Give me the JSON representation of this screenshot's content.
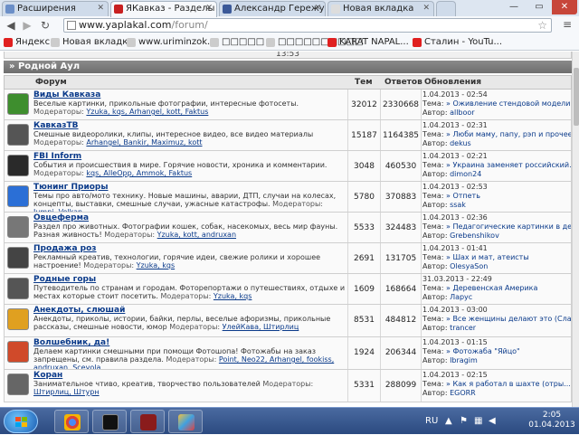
{
  "tabs": [
    {
      "label": "Расширения",
      "active": false
    },
    {
      "label": "ЯКавказ - Разделы",
      "active": true
    },
    {
      "label": "Александр Гережун",
      "active": false
    },
    {
      "label": "Новая вкладка",
      "active": false
    }
  ],
  "address": {
    "host": "www.yaplakal.com",
    "path": "/forum/"
  },
  "bookmarks": [
    "Яндекс",
    "Новая вкладка",
    "www.uriminzok...",
    "□□□□□",
    "□□□□□□□□□□",
    "KARAT NAPAL...",
    "Сталин - YouTu..."
  ],
  "category": "» Родной Аул",
  "prev_row_text": "13:53",
  "columns": {
    "forum": "Форум",
    "topics": "Тем",
    "replies": "Ответов",
    "updates": "Обновления"
  },
  "mods_label": "Модераторы:",
  "topic_label": "Тема:",
  "author_label": "Автор:",
  "forums": [
    {
      "title": "Виды Кавказа",
      "desc": "Веселые картинки, прикольные фотографии, интересные фотосеты.",
      "mods": "Yzuka, kqs, Arhangel, kott, Faktus",
      "topics": "32012",
      "replies": "2330668",
      "date": "1.04.2013 - 02:54",
      "topic": "» Оживление стендовой модели ...",
      "author": "allboor",
      "icon": "#3e8e2e"
    },
    {
      "title": "КавказТВ",
      "desc": "Смешные видеоролики, клипы, интересное видео, все видео материалы",
      "mods": "Arhangel, Bankir, Maximuz, kott",
      "topics": "15187",
      "replies": "1164385",
      "date": "1.04.2013 - 02:31",
      "topic": "» Люби маму, папу, рэп и прочее...",
      "author": "dekus",
      "icon": "#555555"
    },
    {
      "title": "FBI Inform",
      "desc": "События и происшествия в мире. Горячие новости, хроника и комментарии.",
      "mods": "kqs, AlleOpp, Ammok, Faktus",
      "topics": "3048",
      "replies": "460530",
      "date": "1.04.2013 - 02:21",
      "topic": "» Украина заменяет российский...",
      "author": "dimon24",
      "icon": "#2a2a2a"
    },
    {
      "title": "Тюнинг Приоры",
      "desc": "Темы про авто/мото технику. Новые машины, аварии, ДТП, случаи на колесах, концепты, выставки, смешные случаи, ужасные катастрофы.",
      "mods": "Jumpi, Velkan",
      "topics": "5780",
      "replies": "370883",
      "date": "1.04.2013 - 02:53",
      "topic": "» Отпеть",
      "author": "ssak",
      "icon": "#2b6fd6"
    },
    {
      "title": "Овцеферма",
      "desc": "Раздел про животных. Фотографии кошек, собак, насекомых, весь мир фауны. Разная живность!",
      "mods": "Yzuka, kott, andruxan",
      "topics": "5533",
      "replies": "324483",
      "date": "1.04.2013 - 02:36",
      "topic": "» Педагогические картинки в детско...",
      "author": "Grebenshikov",
      "icon": "#777777"
    },
    {
      "title": "Продажа роз",
      "desc": "Рекламный креатив, технологии, горячие идеи, свежие ролики и хорошее настроение!",
      "mods": "Yzuka, kqs",
      "topics": "2691",
      "replies": "131705",
      "date": "1.04.2013 - 01:41",
      "topic": "» Шах и мат, атеисты",
      "author": "OlesyaSon",
      "icon": "#444444"
    },
    {
      "title": "Родные горы",
      "desc": "Путеводитель по странам и городам. Фоторепортажи о путешествиях, отдыхе и местах которые стоит посетить.",
      "mods": "Yzuka, kqs",
      "topics": "1609",
      "replies": "168664",
      "date": "31.03.2013 - 22:49",
      "topic": "» Деревенская Америка",
      "author": "Ларус",
      "icon": "#555555"
    },
    {
      "title": "Анекдоты, слюшай",
      "desc": "Анекдоты, приколы, истории, байки, перлы, веселые афоризмы, прикольные рассказы, смешные новости, юмор",
      "mods": "УлейКава, Штирлиц",
      "topics": "8531",
      "replies": "484812",
      "date": "1.04.2013 - 03:00",
      "topic": "» Все женщины делают это (Сла...",
      "author": "trancer",
      "icon": "#e0a020"
    },
    {
      "title": "Волшебник, да!",
      "desc": "Делаем картинки смешными при помощи Фотошопа! Фотожабы на заказ запрещены, см. правила раздела.",
      "mods": "Point, Neo22, Arhangel, fookiss, andruxan, Scevola",
      "topics": "1924",
      "replies": "206344",
      "date": "1.04.2013 - 01:15",
      "topic": "» Фотожаба \"Яйцо\"",
      "author": "Ibragim",
      "icon": "#d04a2a"
    },
    {
      "title": "Коран",
      "desc": "Занимательное чтиво, креатив, творчество пользователей",
      "mods": "Штирлиц, Штурн",
      "topics": "5331",
      "replies": "288099",
      "date": "1.04.2013 - 02:15",
      "topic": "» Как я работал в шахте (отры...",
      "author": "EGORR",
      "icon": "#666666"
    }
  ],
  "tray": {
    "lang": "RU",
    "time": "2:05",
    "date": "01.04.2013"
  }
}
